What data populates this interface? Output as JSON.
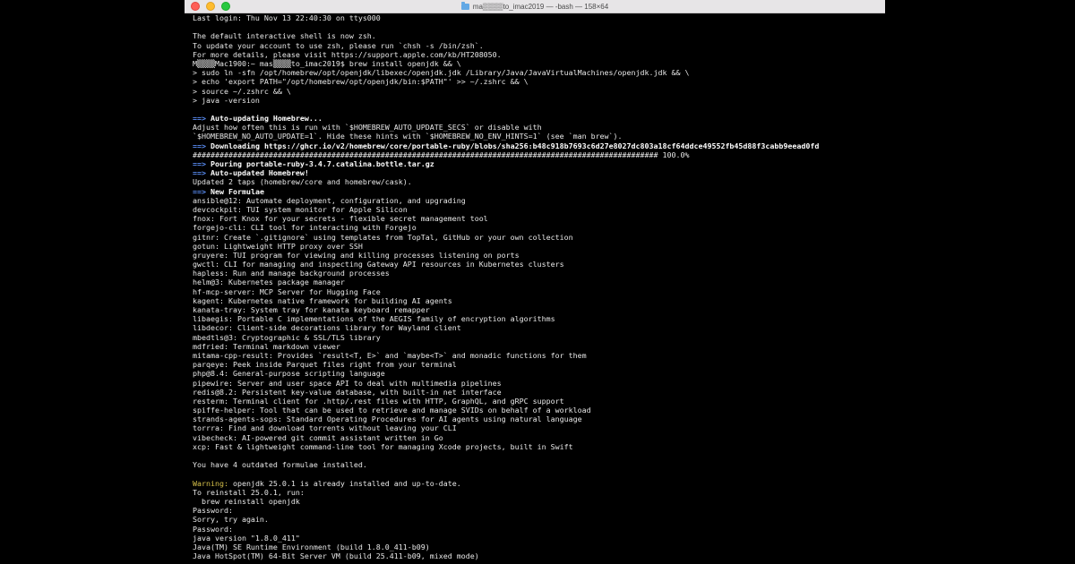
{
  "window": {
    "title": "ma▒▒▒▒to_imac2019 — -bash — 158×64",
    "colors": {
      "close": "#fe5f57",
      "minimize": "#febc2e",
      "maximize": "#28c840",
      "arrow": "#5b8ff7",
      "warning": "#d6c14a"
    }
  },
  "terminal": {
    "lines": [
      {
        "text": "Last login: Thu Nov 13 22:40:30 on ttys000"
      },
      {
        "text": ""
      },
      {
        "text": "The default interactive shell is now zsh."
      },
      {
        "text": "To update your account to use zsh, please run `chsh -s /bin/zsh`."
      },
      {
        "text": "For more details, please visit https://support.apple.com/kb/HT208050."
      },
      {
        "text": "M▒▒▒▒Mac1900:~ mas▒▒▒▒to_imac2019$ brew install openjdk && \\"
      },
      {
        "text": "> sudo ln -sfn /opt/homebrew/opt/openjdk/libexec/openjdk.jdk /Library/Java/JavaVirtualMachines/openjdk.jdk && \\"
      },
      {
        "text": "> echo 'export PATH=\"/opt/homebrew/opt/openjdk/bin:$PATH\"' >> ~/.zshrc && \\"
      },
      {
        "text": "> source ~/.zshrc && \\"
      },
      {
        "text": "> java -version"
      },
      {
        "text": ""
      },
      {
        "arrow": "==>",
        "bold": "Auto-updating Homebrew..."
      },
      {
        "text": "Adjust how often this is run with `$HOMEBREW_AUTO_UPDATE_SECS` or disable with"
      },
      {
        "text": "`$HOMEBREW_NO_AUTO_UPDATE=1`. Hide these hints with `$HOMEBREW_NO_ENV_HINTS=1` (see `man brew`)."
      },
      {
        "arrow": "==>",
        "bold": "Downloading https://ghcr.io/v2/homebrew/core/portable-ruby/blobs/sha256:b48c918b7693c6d27e8027dc803a18cf64ddce49552fb45d88f3cabb9eead0fd"
      },
      {
        "text": "######################################################################################################## 100.0%"
      },
      {
        "arrow": "==>",
        "bold": "Pouring portable-ruby-3.4.7.catalina.bottle.tar.gz"
      },
      {
        "arrow": "==>",
        "bold": "Auto-updated Homebrew!"
      },
      {
        "text": "Updated 2 taps (homebrew/core and homebrew/cask)."
      },
      {
        "arrow": "==>",
        "bold": "New Formulae"
      },
      {
        "text": "ansible@12: Automate deployment, configuration, and upgrading"
      },
      {
        "text": "devcockpit: TUI system monitor for Apple Silicon"
      },
      {
        "text": "fnox: Fort Knox for your secrets - flexible secret management tool"
      },
      {
        "text": "forgejo-cli: CLI tool for interacting with Forgejo"
      },
      {
        "text": "gitnr: Create `.gitignore` using templates from TopTal, GitHub or your own collection"
      },
      {
        "text": "gotun: Lightweight HTTP proxy over SSH"
      },
      {
        "text": "gruyere: TUI program for viewing and killing processes listening on ports"
      },
      {
        "text": "gwctl: CLI for managing and inspecting Gateway API resources in Kubernetes clusters"
      },
      {
        "text": "hapless: Run and manage background processes"
      },
      {
        "text": "helm@3: Kubernetes package manager"
      },
      {
        "text": "hf-mcp-server: MCP Server for Hugging Face"
      },
      {
        "text": "kagent: Kubernetes native framework for building AI agents"
      },
      {
        "text": "kanata-tray: System tray for kanata keyboard remapper"
      },
      {
        "text": "libaegis: Portable C implementations of the AEGIS family of encryption algorithms"
      },
      {
        "text": "libdecor: Client-side decorations library for Wayland client"
      },
      {
        "text": "mbedtls@3: Cryptographic & SSL/TLS library"
      },
      {
        "text": "mdfried: Terminal markdown viewer"
      },
      {
        "text": "mitama-cpp-result: Provides `result<T, E>` and `maybe<T>` and monadic functions for them"
      },
      {
        "text": "parqeye: Peek inside Parquet files right from your terminal"
      },
      {
        "text": "php@8.4: General-purpose scripting language"
      },
      {
        "text": "pipewire: Server and user space API to deal with multimedia pipelines"
      },
      {
        "text": "redis@8.2: Persistent key-value database, with built-in net interface"
      },
      {
        "text": "resterm: Terminal client for .http/.rest files with HTTP, GraphQL, and gRPC support"
      },
      {
        "text": "spiffe-helper: Tool that can be used to retrieve and manage SVIDs on behalf of a workload"
      },
      {
        "text": "strands-agents-sops: Standard Operating Procedures for AI agents using natural language"
      },
      {
        "text": "torrra: Find and download torrents without leaving your CLI"
      },
      {
        "text": "vibecheck: AI-powered git commit assistant written in Go"
      },
      {
        "text": "xcp: Fast & lightweight command-line tool for managing Xcode projects, built in Swift"
      },
      {
        "text": ""
      },
      {
        "text": "You have 4 outdated formulae installed."
      },
      {
        "text": ""
      },
      {
        "warn": "Warning:",
        "text": " openjdk 25.0.1 is already installed and up-to-date."
      },
      {
        "text": "To reinstall 25.0.1, run:"
      },
      {
        "text": "  brew reinstall openjdk"
      },
      {
        "text": "Password:"
      },
      {
        "text": "Sorry, try again."
      },
      {
        "text": "Password:"
      },
      {
        "text": "java version \"1.8.0_411\""
      },
      {
        "text": "Java(TM) SE Runtime Environment (build 1.8.0_411-b09)"
      },
      {
        "text": "Java HotSpot(TM) 64-Bit Server VM (build 25.411-b09, mixed mode)"
      }
    ]
  }
}
